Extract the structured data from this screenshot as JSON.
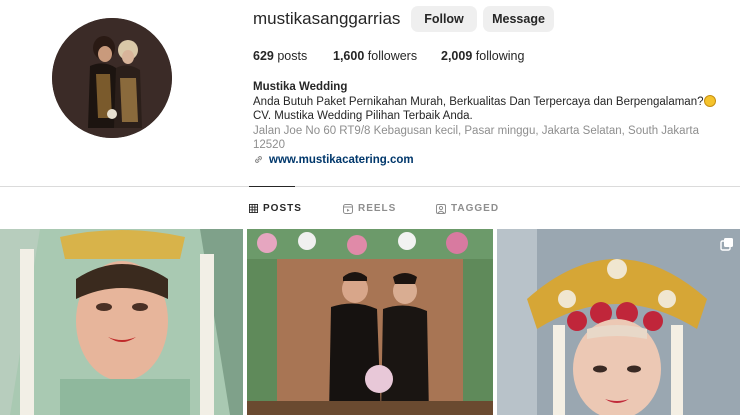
{
  "profile": {
    "username": "mustikasanggarrias",
    "follow_label": "Follow",
    "message_label": "Message",
    "posts_count": "629",
    "posts_label": "posts",
    "followers_count": "1,600",
    "followers_label": "followers",
    "following_count": "2,009",
    "following_label": "following"
  },
  "bio": {
    "name": "Mustika Wedding",
    "line1": "Anda Butuh Paket Pernikahan Murah, Berkualitas Dan Terpercaya dan Berpengalaman?",
    "line2": "CV. Mustika Wedding Pilihan Terbaik Anda.",
    "location": "Jalan Joe No 60 RT9/8 Kebagusan kecil, Pasar minggu, Jakarta Selatan, South Jakarta 12520",
    "link": "www.mustikacatering.com"
  },
  "tabs": [
    {
      "label": "POSTS",
      "icon": "grid-icon",
      "active": true
    },
    {
      "label": "REELS",
      "icon": "reels-icon",
      "active": false
    },
    {
      "label": "TAGGED",
      "icon": "tagged-icon",
      "active": false
    }
  ],
  "colors": {
    "text": "#262626",
    "muted": "#8e8e8e",
    "link": "#00376b",
    "button_bg": "#efefef",
    "divider": "#dbdbdb"
  }
}
